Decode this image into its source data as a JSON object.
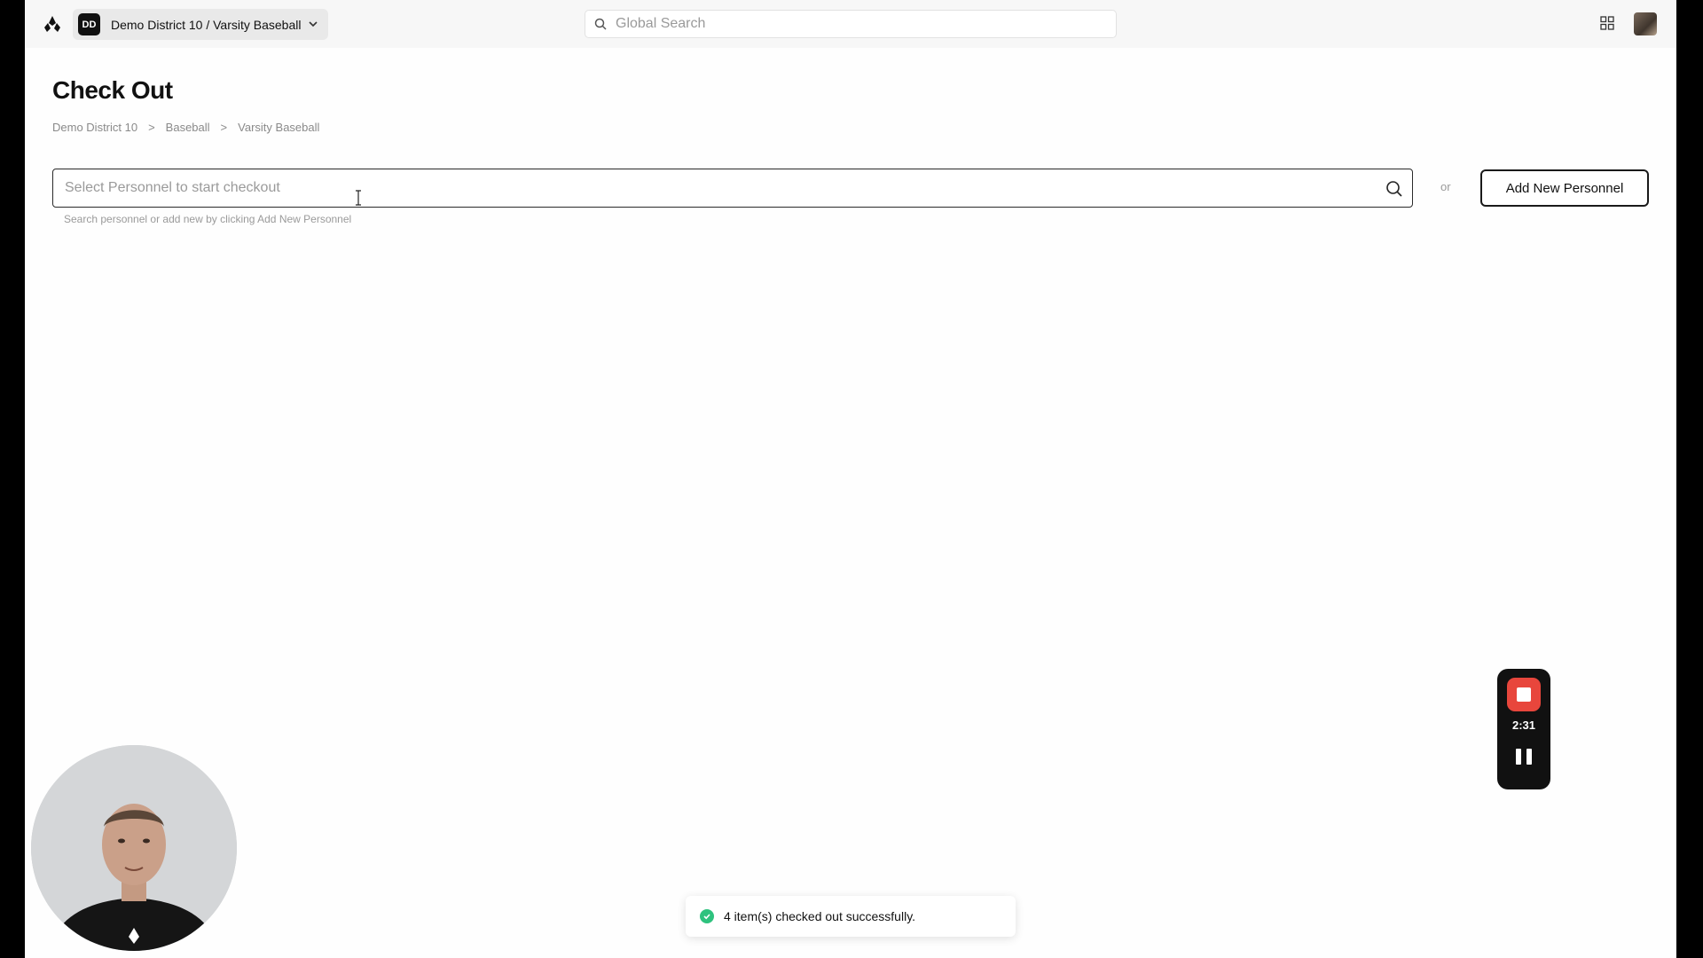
{
  "topbar": {
    "org_initials": "DD",
    "org_label": "Demo District 10 / Varsity Baseball",
    "global_search_placeholder": "Global Search"
  },
  "page": {
    "title": "Check Out",
    "breadcrumbs": [
      "Demo District 10",
      "Baseball",
      "Varsity Baseball"
    ],
    "breadcrumb_separator": ">"
  },
  "checkout": {
    "personnel_placeholder": "Select Personnel to start checkout",
    "personnel_value": "",
    "helper_text": "Search personnel or add new by clicking Add New Personnel",
    "or_text": "or",
    "add_button_label": "Add New Personnel"
  },
  "recorder": {
    "elapsed": "2:31",
    "stop_color": "#e8463c"
  },
  "toast": {
    "message": "4 item(s) checked out successfully.",
    "status_color": "#2ec27e"
  }
}
